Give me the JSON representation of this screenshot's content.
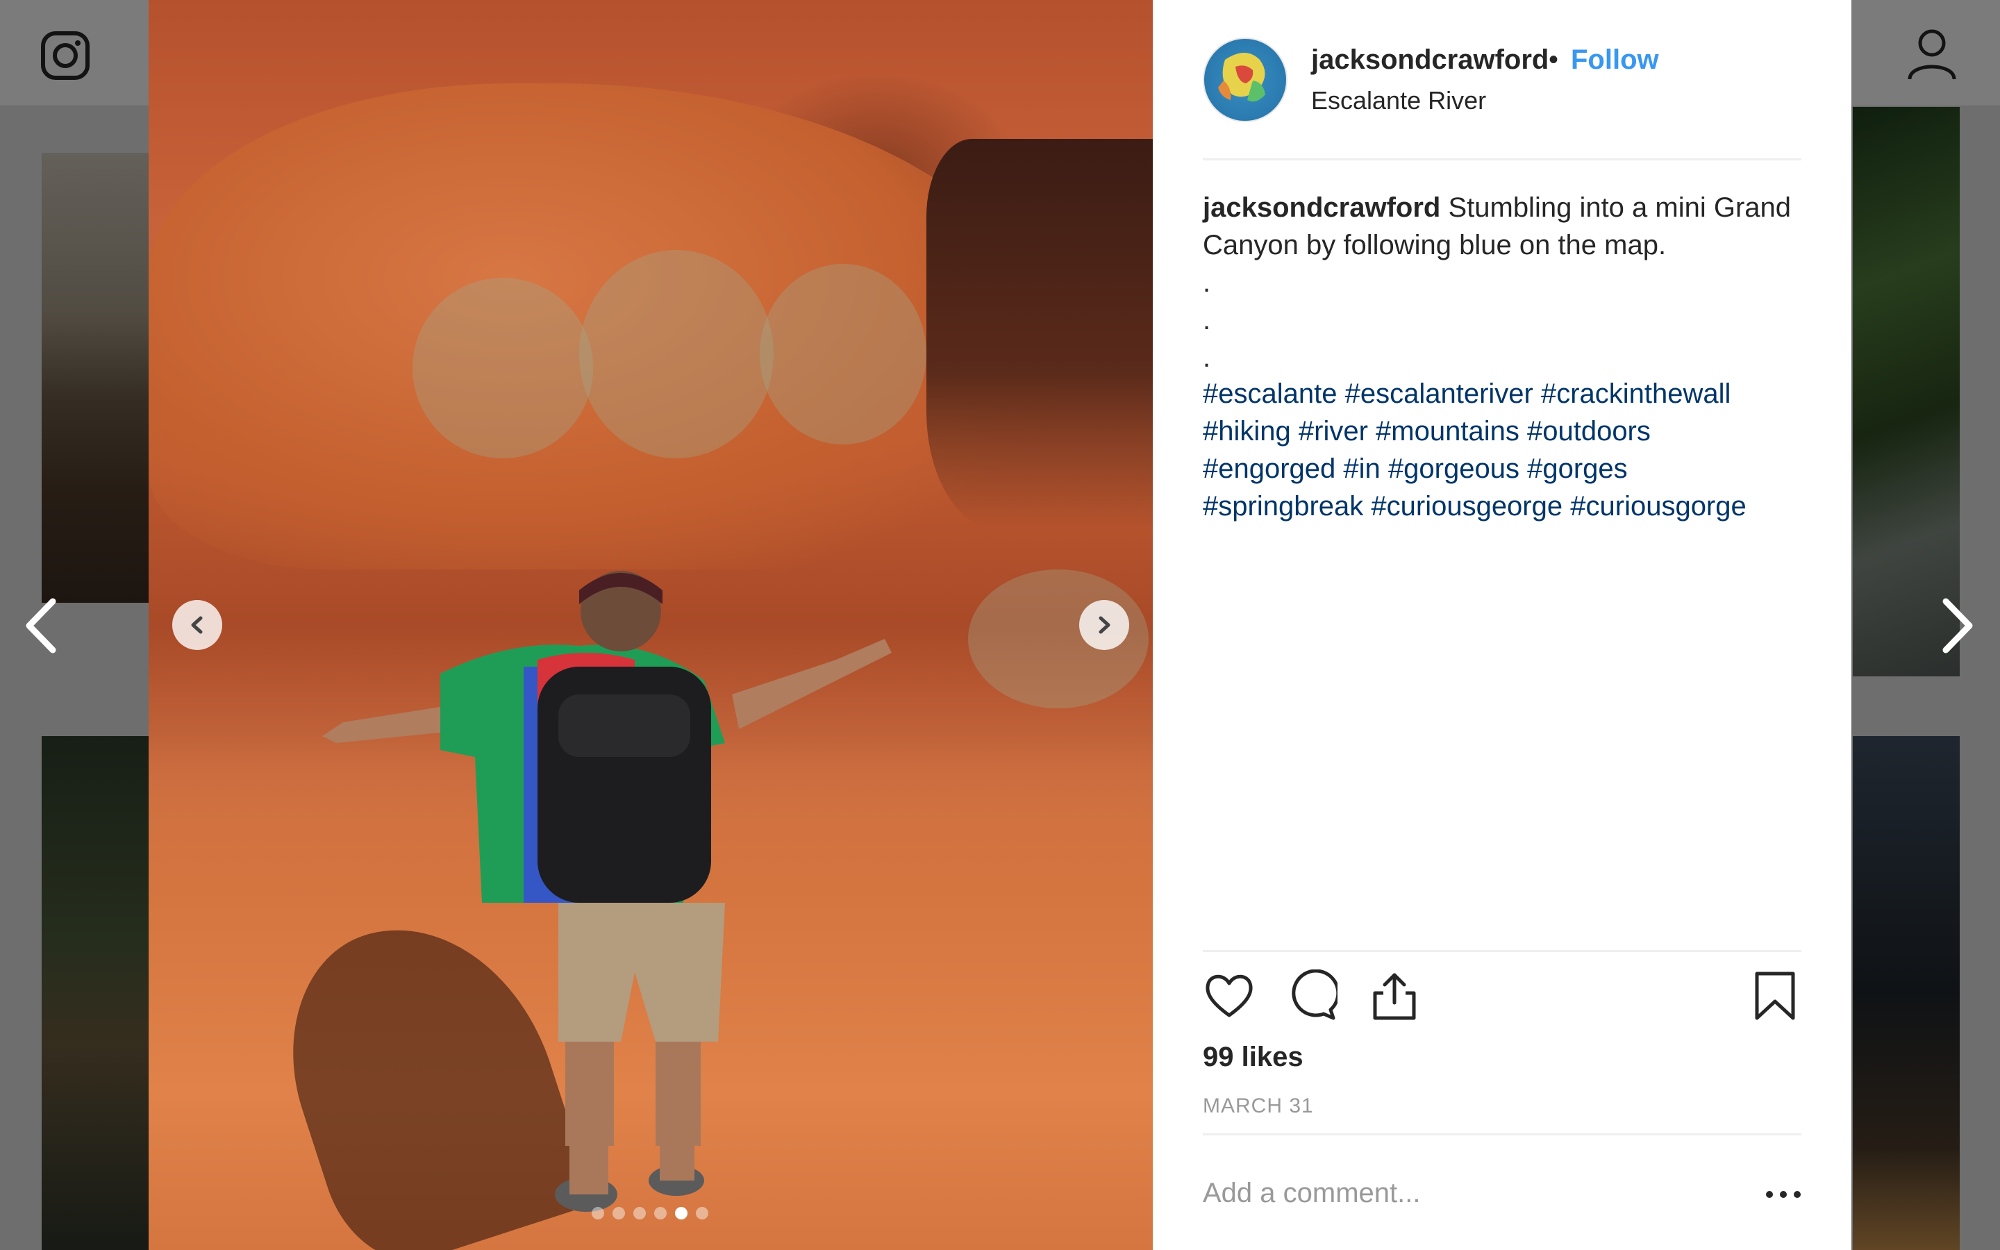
{
  "post": {
    "username": "jacksondcrawford",
    "separator": "•",
    "follow_label": "Follow",
    "location": "Escalante River",
    "caption_user": "jacksondcrawford",
    "caption_text": "Stumbling into a mini Grand Canyon by following blue on the map.",
    "caption_dots": [
      ".",
      ".",
      "."
    ],
    "hashtags": [
      "#escalante",
      "#escalanteriver",
      "#crackinthewall",
      "#hiking",
      "#river",
      "#mountains",
      "#outdoors",
      "#engorged",
      "#in",
      "#gorgeous",
      "#gorges",
      "#springbreak",
      "#curiousgeorge",
      "#curiousgorge"
    ],
    "likes": "99 likes",
    "date": "MARCH 31",
    "comment_placeholder": "Add a comment..."
  },
  "carousel": {
    "count": 6,
    "active_index": 4
  },
  "icons": {
    "header_left": "instagram-icon",
    "header_right": "profile-icon",
    "actions": [
      "heart-icon",
      "comment-icon",
      "share-icon",
      "bookmark-icon"
    ],
    "more": "more-options-icon"
  },
  "colors": {
    "link": "#3897f0",
    "hashtag": "#003569",
    "muted": "#999999",
    "text": "#262626"
  }
}
